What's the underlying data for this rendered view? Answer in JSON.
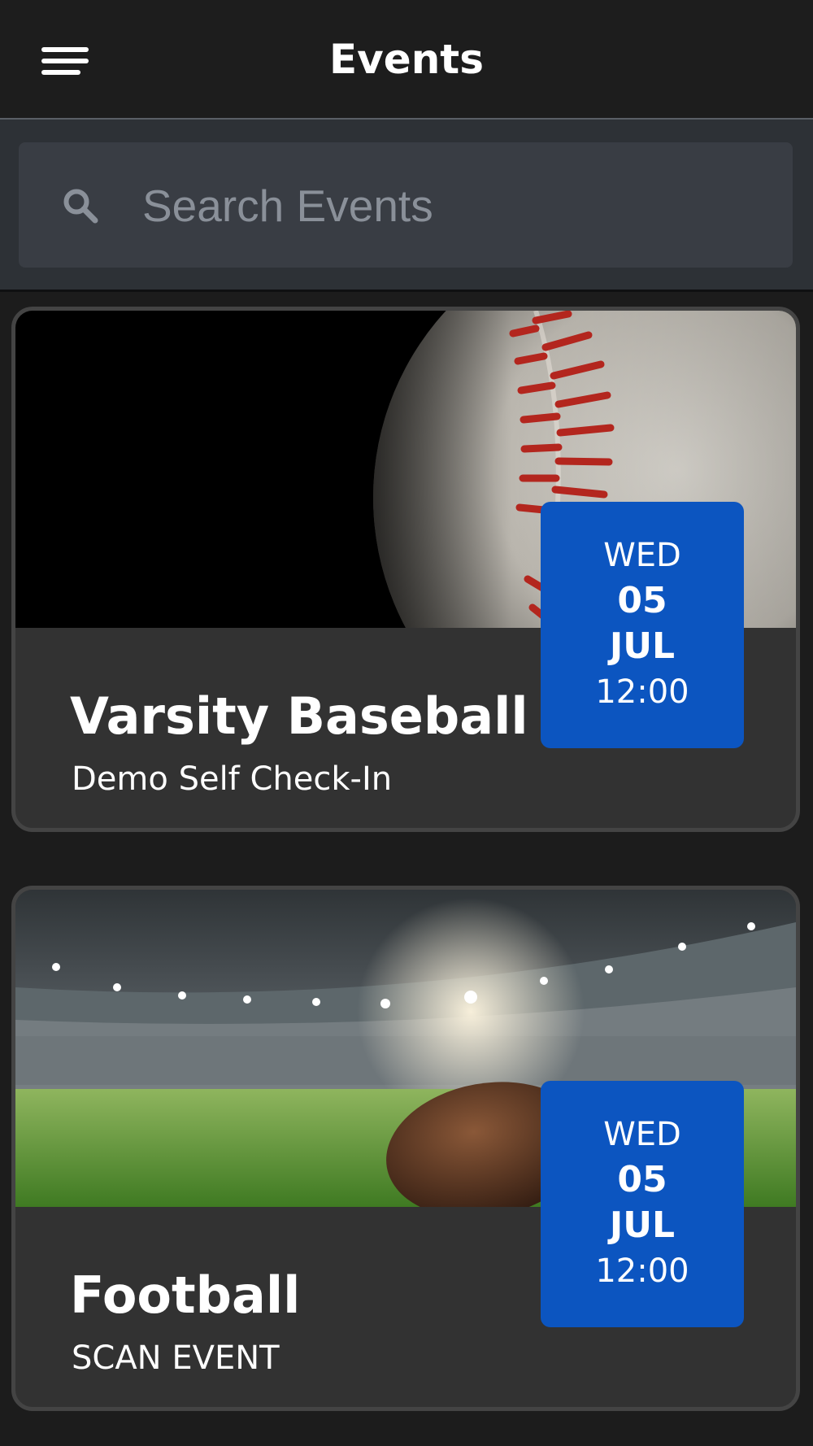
{
  "header": {
    "title": "Events"
  },
  "search": {
    "placeholder": "Search Events",
    "value": ""
  },
  "events": [
    {
      "title": "Varsity Baseball",
      "subtitle": "Demo Self Check-In",
      "image": "baseball-image",
      "date": {
        "weekday": "WED",
        "day": "05",
        "month": "JUL",
        "time": "12:00"
      }
    },
    {
      "title": "Football",
      "subtitle": "SCAN EVENT",
      "image": "football-stadium-image",
      "date": {
        "weekday": "WED",
        "day": "05",
        "month": "JUL",
        "time": "12:00"
      }
    }
  ],
  "colors": {
    "background": "#1c1c1c",
    "header_background": "#1d1d1d",
    "search_region_background": "#2d3136",
    "search_box_background": "#393d44",
    "card_background": "#323232",
    "date_badge": "#0c55c0"
  },
  "icons": {
    "menu": "hamburger-menu-icon",
    "search": "search-icon"
  }
}
